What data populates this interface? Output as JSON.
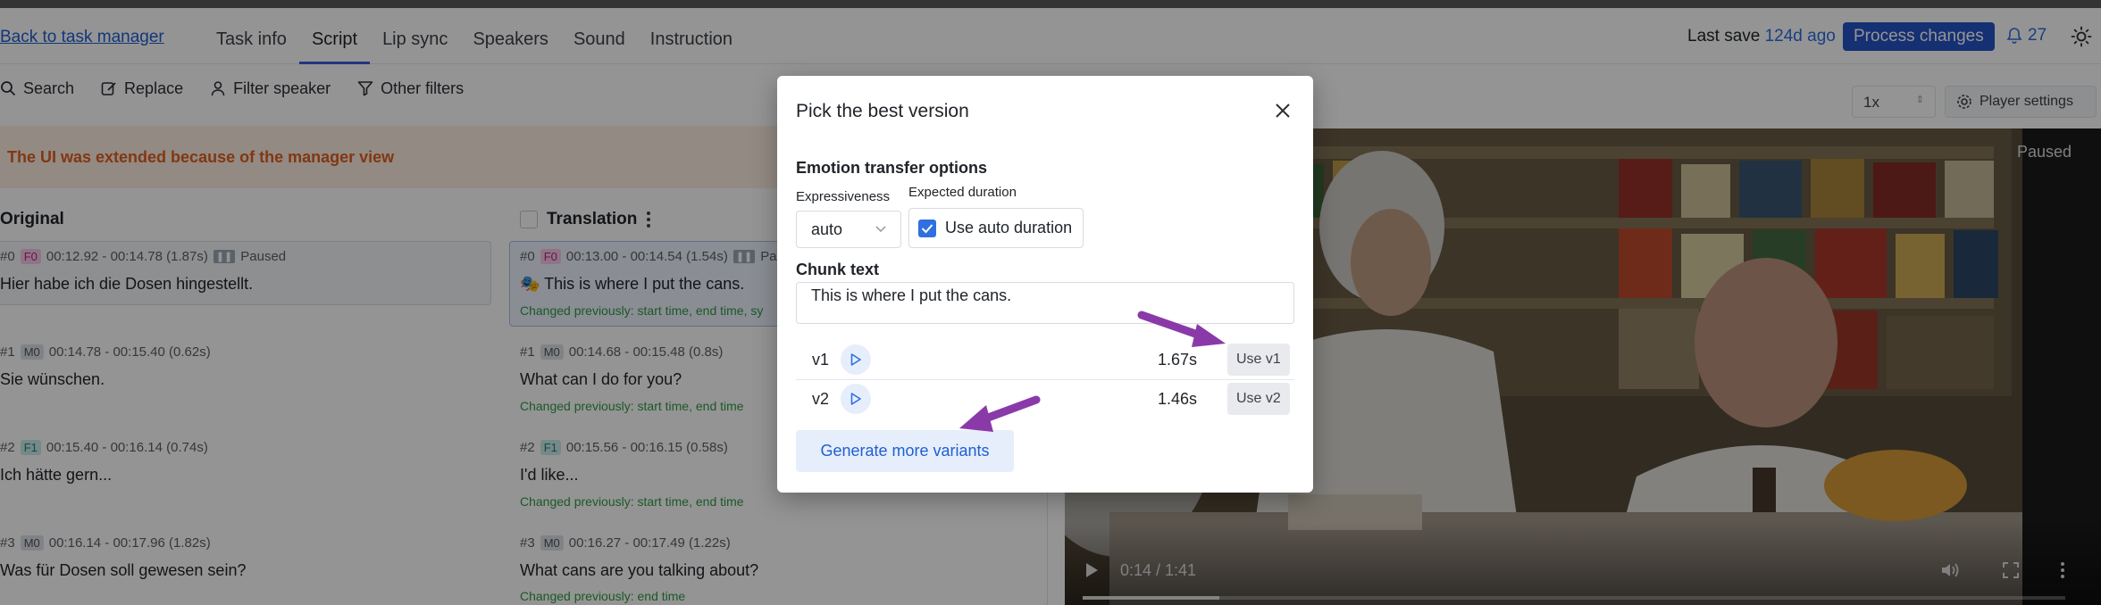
{
  "nav": {
    "back_link": "Back to task manager",
    "tabs": [
      {
        "label": "Task info"
      },
      {
        "label": "Script"
      },
      {
        "label": "Lip sync"
      },
      {
        "label": "Speakers"
      },
      {
        "label": "Sound"
      },
      {
        "label": "Instruction"
      }
    ],
    "active_tab": "Script",
    "last_save_label": "Last save",
    "last_save_ago": "124d ago",
    "process_button": "Process changes",
    "notification_count": "27"
  },
  "toolbar": {
    "search": "Search",
    "replace": "Replace",
    "filter_speaker": "Filter speaker",
    "other_filters": "Other filters"
  },
  "banner": "The UI was extended because of the manager view",
  "columns": {
    "original": "Original",
    "translation": "Translation"
  },
  "segments": [
    {
      "orig": {
        "index": "#0",
        "speaker": "F0",
        "time": "00:12.92 - 00:14.78 (1.87s)",
        "status": "Paused",
        "text": "Hier habe ich die Dosen hingestellt."
      },
      "trans": {
        "index": "#0",
        "speaker": "F0",
        "time": "00:13.00 - 00:14.54 (1.54s)",
        "status": "Pa",
        "emoji": "🎭",
        "text": "This is where I put the cans.",
        "changed": "Changed previously: start time, end time, sy"
      }
    },
    {
      "orig": {
        "index": "#1",
        "speaker": "M0",
        "time": "00:14.78 - 00:15.40 (0.62s)",
        "text": "Sie wünschen."
      },
      "trans": {
        "index": "#1",
        "speaker": "M0",
        "time": "00:14.68 - 00:15.48 (0.8s)",
        "text": "What can I do for you?",
        "changed": "Changed previously: start time, end time"
      }
    },
    {
      "orig": {
        "index": "#2",
        "speaker": "F1",
        "time": "00:15.40 - 00:16.14 (0.74s)",
        "text": "Ich hätte gern..."
      },
      "trans": {
        "index": "#2",
        "speaker": "F1",
        "time": "00:15.56 - 00:16.15 (0.58s)",
        "text": "I'd like...",
        "changed": "Changed previously: start time, end time"
      }
    },
    {
      "orig": {
        "index": "#3",
        "speaker": "M0",
        "time": "00:16.14 - 00:17.96 (1.82s)",
        "text": "Was für Dosen soll gewesen sein?"
      },
      "trans": {
        "index": "#3",
        "speaker": "M0",
        "time": "00:16.27 - 00:17.49 (1.22s)",
        "text": "What cans are you talking about?",
        "changed": "Changed previously: end time"
      }
    }
  ],
  "player": {
    "speed": "1x",
    "settings_label": "Player settings",
    "status": "Paused",
    "time": "0:14 / 1:41",
    "progress_fraction": 0.139
  },
  "modal": {
    "title": "Pick the best version",
    "section_title": "Emotion transfer options",
    "expressiveness_label": "Expressiveness",
    "expressiveness_value": "auto",
    "expected_duration_label": "Expected duration",
    "use_auto_duration": "Use auto duration",
    "chunk_text_label": "Chunk text",
    "chunk_text": "This is where I put the cans.",
    "variants": [
      {
        "name": "v1",
        "duration": "1.67s",
        "use_label": "Use v1"
      },
      {
        "name": "v2",
        "duration": "1.46s",
        "use_label": "Use v2"
      }
    ],
    "generate_button": "Generate more variants"
  },
  "colors": {
    "accent": "#2554c7",
    "banner_text": "#e0601f",
    "arrow": "#8a3aa8"
  }
}
